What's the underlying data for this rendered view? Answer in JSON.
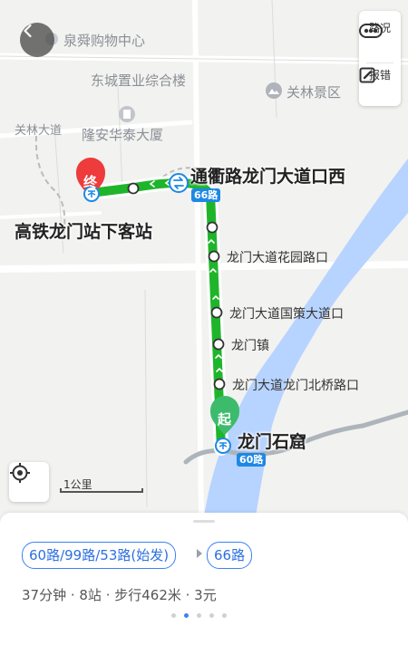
{
  "map": {
    "pois": {
      "quanshun_mall": "泉舜购物中心",
      "dongcheng": "东城置业综合楼",
      "guanlin_scenic": "关林景区",
      "guanlin_road": "关林大道",
      "longan": "隆安华泰大厦"
    },
    "end_stop": {
      "name": "高铁龙门站下客站",
      "marker": "终"
    },
    "transfer_stop": {
      "name": "通衢路龙门大道口西",
      "badge": "66路"
    },
    "intermediate_stops": [
      "龙门大道花园路口",
      "龙门大道国策大道口",
      "龙门镇",
      "龙门大道龙门北桥路口"
    ],
    "start_stop": {
      "name": "龙门石窟",
      "marker": "起",
      "badge": "60路"
    },
    "scale_label": "1公里",
    "colors": {
      "route": "#1fb52b",
      "water": "#b7d3ff",
      "badge": "#1e88e5",
      "end_marker": "#ee3b3b",
      "start_marker": "#3dbb6c"
    }
  },
  "toolbar": {
    "traffic_label": "路况",
    "report_label": "报错",
    "back_icon": "chevron-left-icon",
    "traffic_icon": "traffic-icon",
    "report_icon": "edit-icon",
    "locate_icon": "locate-icon"
  },
  "plan": {
    "segments": [
      "60路/99路/53路(始发)",
      "66路"
    ],
    "summary": "37分钟 · 8站 · 步行462米 · 3元",
    "pages": 5,
    "active_page": 2
  }
}
